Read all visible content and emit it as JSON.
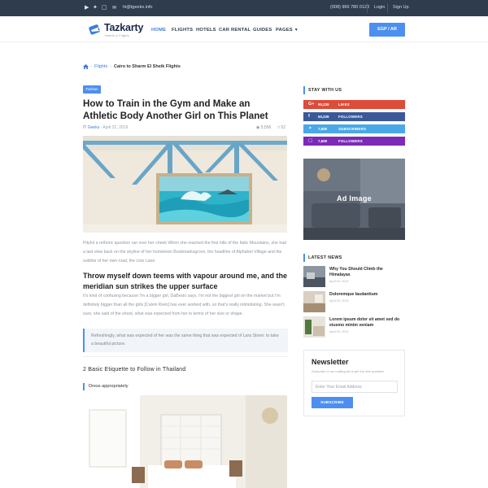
{
  "topbar": {
    "social_icons": [
      "youtube-icon",
      "twitter-icon",
      "instagram-icon"
    ],
    "email": "hi@tgeeks.info",
    "phone": "(008) 966 780 0123",
    "login": "Login",
    "signup": "Sign Up"
  },
  "header": {
    "brand": "Tazkarty",
    "tagline": "Hotels & Flights",
    "nav": [
      "HOME",
      "FLIGHTS",
      "HOTELS",
      "CAR RENTAL",
      "GUIDES",
      "PAGES"
    ],
    "lang_button": "EGP / AR"
  },
  "breadcrumb": {
    "flights": "Flights",
    "separator": "›",
    "current": "Cairo to Sharm El Sheik Flights"
  },
  "article": {
    "tag": "Fashion",
    "title": "How to Train in the Gym and Make an Athletic Body Another Girl on This Planet",
    "author": "IT Geeks",
    "date": "- April 22, 2019",
    "views": "5,556",
    "comments": "52",
    "para1": "Pityful a rethoric question ran over her cheek When she reached the first hills of the Italic Mountains, she had a last view back on the skyline of her hometown Bookmarksgrove, the headline of Alphabet Village and the subline of her own road, the Line Lane.",
    "heading2": "Throw myself down teems with vapour around me, and the meridian sun strikes the upper surface",
    "para2": "It's kind of confusing because I'm a bigger girl, DaBesio says. I'm not the biggest girl on the market but I'm definitely bigger than all the girls [Calvin Klein] has ever worked with, so that's really intimidating. She wasn't sure, she said of the shoot, what was expected from her in terms of her size or shape.",
    "quote": "Refreshingly, what was expected of her was the same thing that was expected of Lara Stone: to take a beautiful picture.",
    "heading3": "2 Basic Etiquette to Follow in Thailand",
    "heading4": "Dress appropriately"
  },
  "sidebar": {
    "stay_title": "STAY WITH US",
    "social": [
      {
        "icon": "google-plus-icon",
        "count": "90,239",
        "label": "LIKES",
        "color": "#dd4b39"
      },
      {
        "icon": "facebook-icon",
        "count": "50,239",
        "label": "FOLLOWERS",
        "color": "#3b5998"
      },
      {
        "icon": "twitter-icon",
        "count": "7,608",
        "label": "SUBSCRIBERS",
        "color": "#4aa8e8"
      },
      {
        "icon": "instagram-icon",
        "count": "7,608",
        "label": "FOLLOWERS",
        "color": "#7b2bb8"
      }
    ],
    "ad_text": "Ad Image",
    "latest_title": "LATEST NEWS",
    "news": [
      {
        "title": "Why You Should Climb the Himalayas",
        "date": "April 03, 2019"
      },
      {
        "title": "Doloremque laudantium",
        "date": "April 03, 2019"
      },
      {
        "title": "Lorem ipsum dolor sit amet sed do eiusmo minim veniam",
        "date": "April 03, 2019"
      }
    ],
    "newsletter": {
      "title": "Newsletter",
      "subtitle": "Subscribe to our mailing list to get the new updates!",
      "placeholder": "Enter Your Email Address",
      "button": "SUBSCRIBE"
    }
  },
  "colors": {
    "accent": "#4d8ff0",
    "topbar": "#2f3c4d"
  }
}
